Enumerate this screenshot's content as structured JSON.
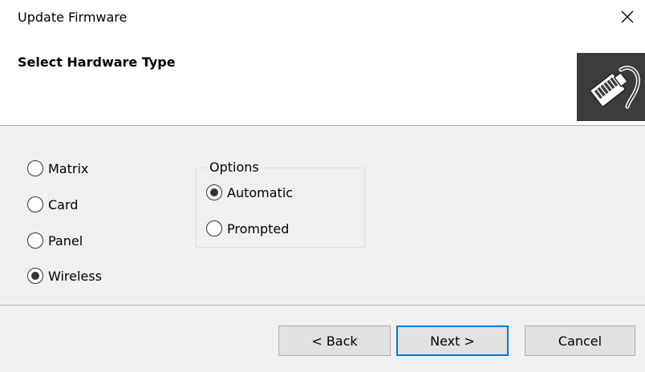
{
  "window": {
    "title": "Update Firmware",
    "close_icon": "close-icon"
  },
  "header": {
    "title": "Select Hardware Type",
    "icon": "network-plug-icon"
  },
  "hardware_types": [
    {
      "label": "Matrix",
      "selected": false
    },
    {
      "label": "Card",
      "selected": false
    },
    {
      "label": "Panel",
      "selected": false
    },
    {
      "label": "Wireless",
      "selected": true
    }
  ],
  "options": {
    "label": "Options",
    "items": [
      {
        "label": "Automatic",
        "selected": true
      },
      {
        "label": "Prompted",
        "selected": false
      }
    ]
  },
  "buttons": {
    "back": "< Back",
    "next": "Next >",
    "cancel": "Cancel"
  },
  "colors": {
    "accent": "#0078d7",
    "panel_background": "#f0f0f0",
    "icon_background": "#3c3c3c"
  }
}
